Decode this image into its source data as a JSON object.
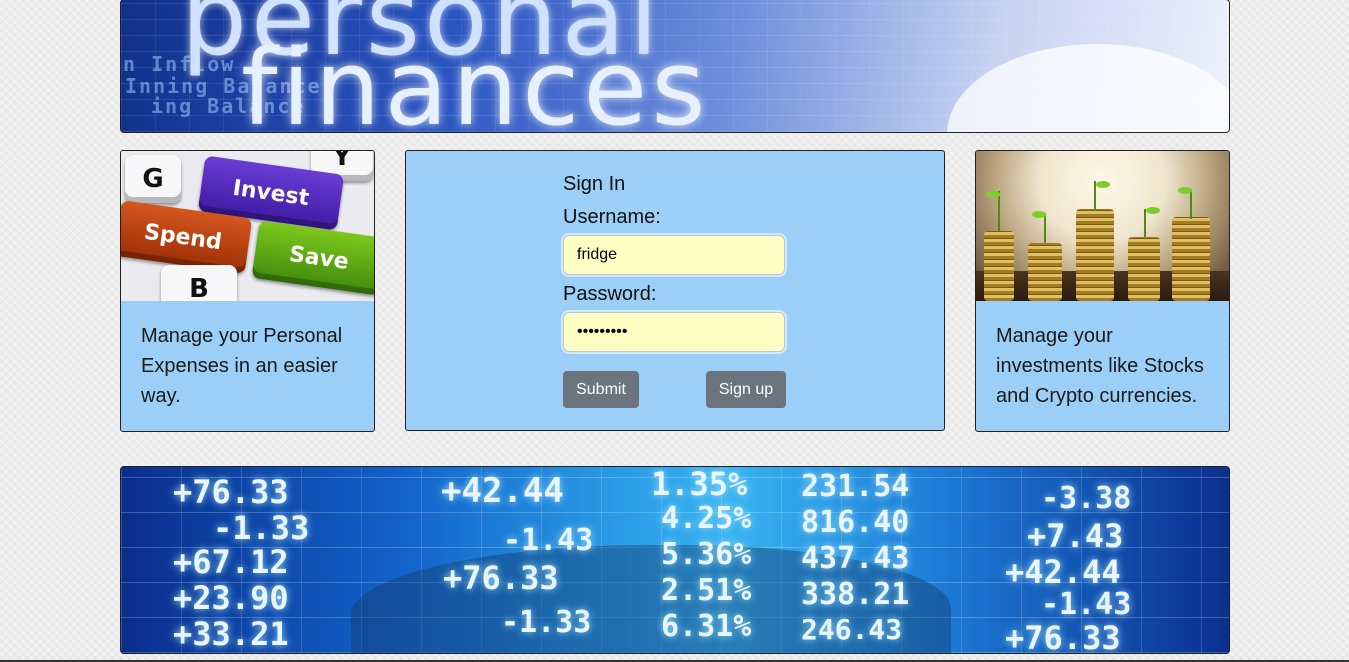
{
  "header_banner": {
    "word1": "personal",
    "word2": "finances",
    "ghost_lines": [
      "Inning Balance",
      "ing Balance",
      "n Inflow"
    ]
  },
  "left_card": {
    "keys": {
      "g": "G",
      "y": "Y",
      "invest": "Invest",
      "spend": "Spend",
      "save": "Save",
      "b": "B"
    },
    "text": "Manage your Personal Expenses in an easier way."
  },
  "signin": {
    "title": "Sign In",
    "username_label": "Username:",
    "username_value": "fridge",
    "password_label": "Password:",
    "password_value": "•••••••••",
    "submit_label": "Submit",
    "signup_label": "Sign up"
  },
  "right_card": {
    "text": "Manage your investments like Stocks and Crypto currencies."
  },
  "stock_banner": {
    "left_column": [
      "+76.33",
      "-1.33",
      "+67.12",
      "+23.90",
      "+33.21"
    ],
    "center_column_a": [
      "+42.44",
      "-1.43",
      "+76.33",
      "-1.33"
    ],
    "center_column_b": [
      "1.35%",
      "4.25%",
      "5.36%",
      "2.51%",
      "6.31%"
    ],
    "center_column_c": [
      "231.54",
      "816.40",
      "437.43",
      "338.21",
      "246.43"
    ],
    "right_column": [
      "-3.38",
      "+7.43",
      "+42.44",
      "-1.43",
      "+76.33"
    ]
  }
}
